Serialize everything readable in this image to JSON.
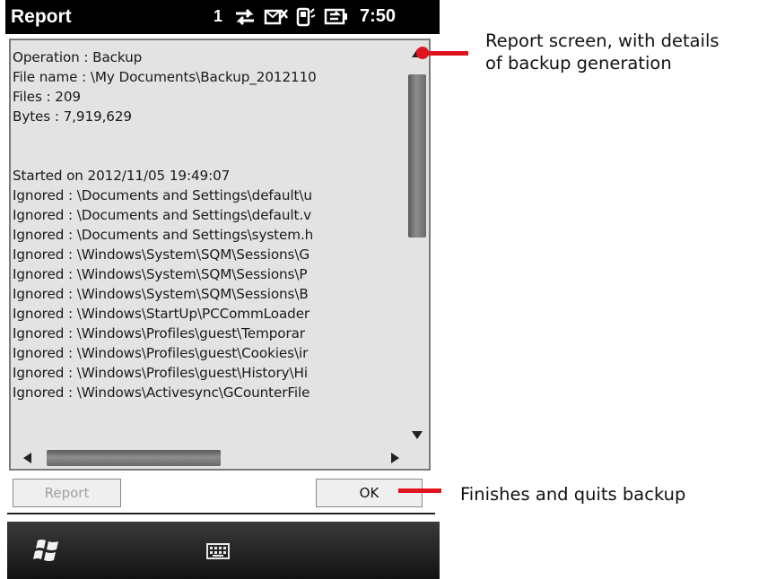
{
  "status_bar": {
    "app_title": "Report",
    "signal_number": "1",
    "clock": "7:50",
    "icons": [
      "sync-icon",
      "message-icon",
      "phone-icon",
      "battery-icon"
    ]
  },
  "report": {
    "lines": [
      "Operation : Backup",
      "File name : \\My Documents\\Backup_2012110",
      "Files : 209",
      "Bytes : 7,919,629",
      "",
      "Started on 2012/11/05 19:49:07",
      "Ignored : \\Documents and Settings\\default\\u",
      "Ignored : \\Documents and Settings\\default.v",
      "Ignored : \\Documents and Settings\\system.h",
      "Ignored : \\Windows\\System\\SQM\\Sessions\\G",
      "Ignored : \\Windows\\System\\SQM\\Sessions\\P",
      "Ignored : \\Windows\\System\\SQM\\Sessions\\B",
      "Ignored : \\Windows\\StartUp\\PCCommLoader",
      "Ignored : \\Windows\\Profiles\\guest\\Temporar",
      "Ignored : \\Windows\\Profiles\\guest\\Cookies\\ir",
      "Ignored : \\Windows\\Profiles\\guest\\History\\Hi",
      "Ignored : \\Windows\\Activesync\\GCounterFile"
    ]
  },
  "buttons": {
    "report_label": "Report",
    "ok_label": "OK"
  },
  "annotations": {
    "report_screen_line1": "Report screen, with details",
    "report_screen_line2": "of backup generation",
    "ok_note": "Finishes and quits backup"
  },
  "colors": {
    "callout": "#e0141f",
    "panel_bg": "#e3e3e3",
    "status_bar_bg": "#000000"
  }
}
